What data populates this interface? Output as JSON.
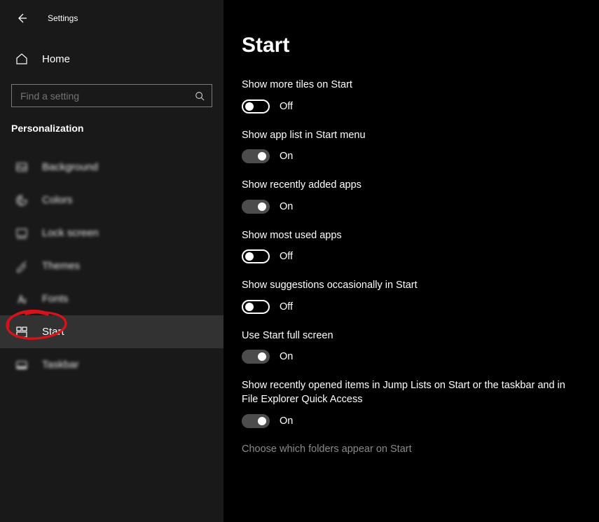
{
  "window_title": "Settings",
  "home_label": "Home",
  "search_placeholder": "Find a setting",
  "category_label": "Personalization",
  "nav_items": [
    {
      "key": "background",
      "label": "Background",
      "blurred": true
    },
    {
      "key": "colors",
      "label": "Colors",
      "blurred": true
    },
    {
      "key": "lockscreen",
      "label": "Lock screen",
      "blurred": true
    },
    {
      "key": "themes",
      "label": "Themes",
      "blurred": true
    },
    {
      "key": "fonts",
      "label": "Fonts",
      "blurred": true
    },
    {
      "key": "start",
      "label": "Start",
      "blurred": false,
      "selected": true
    },
    {
      "key": "taskbar",
      "label": "Taskbar",
      "blurred": true
    }
  ],
  "page_title": "Start",
  "toggle_labels": {
    "on": "On",
    "off": "Off"
  },
  "settings": [
    {
      "key": "more_tiles",
      "label": "Show more tiles on Start",
      "value": false
    },
    {
      "key": "app_list",
      "label": "Show app list in Start menu",
      "value": true
    },
    {
      "key": "recently_added",
      "label": "Show recently added apps",
      "value": true
    },
    {
      "key": "most_used",
      "label": "Show most used apps",
      "value": false
    },
    {
      "key": "suggestions",
      "label": "Show suggestions occasionally in Start",
      "value": false
    },
    {
      "key": "full_screen",
      "label": "Use Start full screen",
      "value": true
    },
    {
      "key": "jump_lists",
      "label": "Show recently opened items in Jump Lists on Start or the taskbar and in File Explorer Quick Access",
      "value": true
    }
  ],
  "link_text": "Choose which folders appear on Start"
}
